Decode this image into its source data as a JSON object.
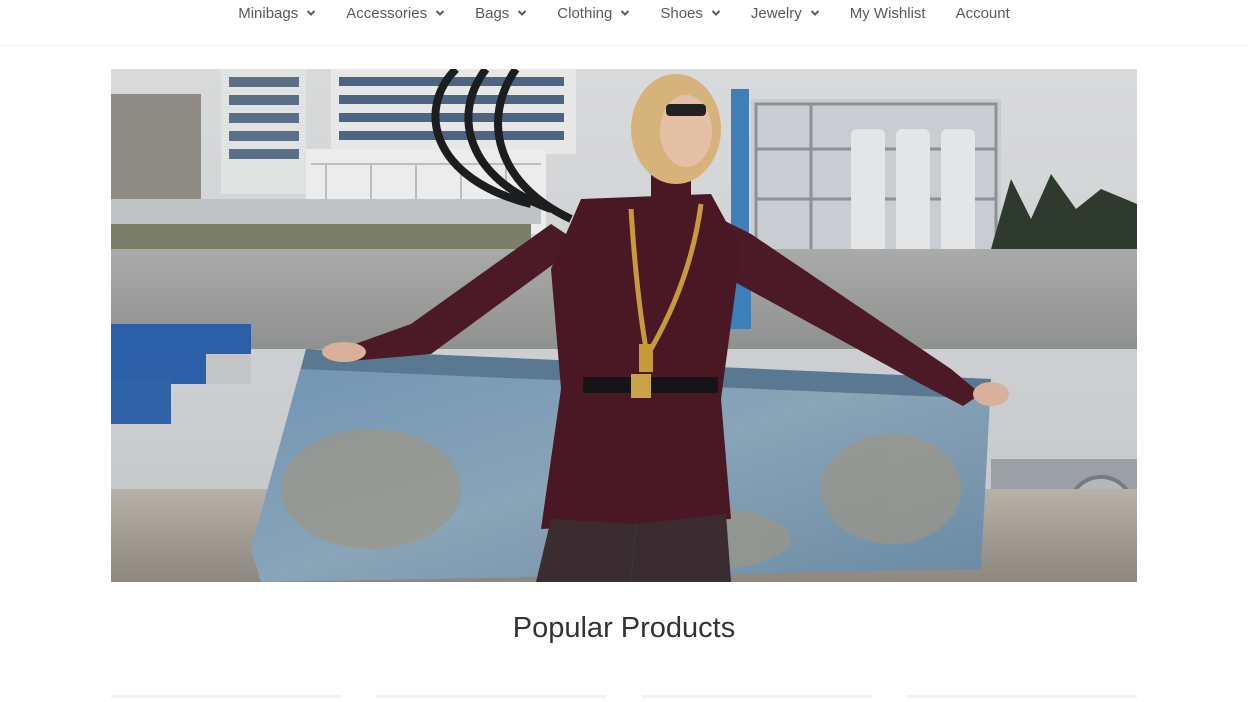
{
  "nav": {
    "items": [
      {
        "label": "Minibags",
        "has_dropdown": true
      },
      {
        "label": "Accessories",
        "has_dropdown": true
      },
      {
        "label": "Bags",
        "has_dropdown": true
      },
      {
        "label": "Clothing",
        "has_dropdown": true
      },
      {
        "label": "Shoes",
        "has_dropdown": true
      },
      {
        "label": "Jewelry",
        "has_dropdown": true
      },
      {
        "label": "My Wishlist",
        "has_dropdown": false
      },
      {
        "label": "Account",
        "has_dropdown": false
      }
    ]
  },
  "hero": {
    "image_subject": "model-in-burgundy-bodysuit-with-gold-chain-necklace-at-industrial-riverside"
  },
  "popular": {
    "title": "Popular Products"
  },
  "colors": {
    "nav_text": "#5a5a5a",
    "heading_text": "#333333",
    "divider": "#eeeeee"
  }
}
